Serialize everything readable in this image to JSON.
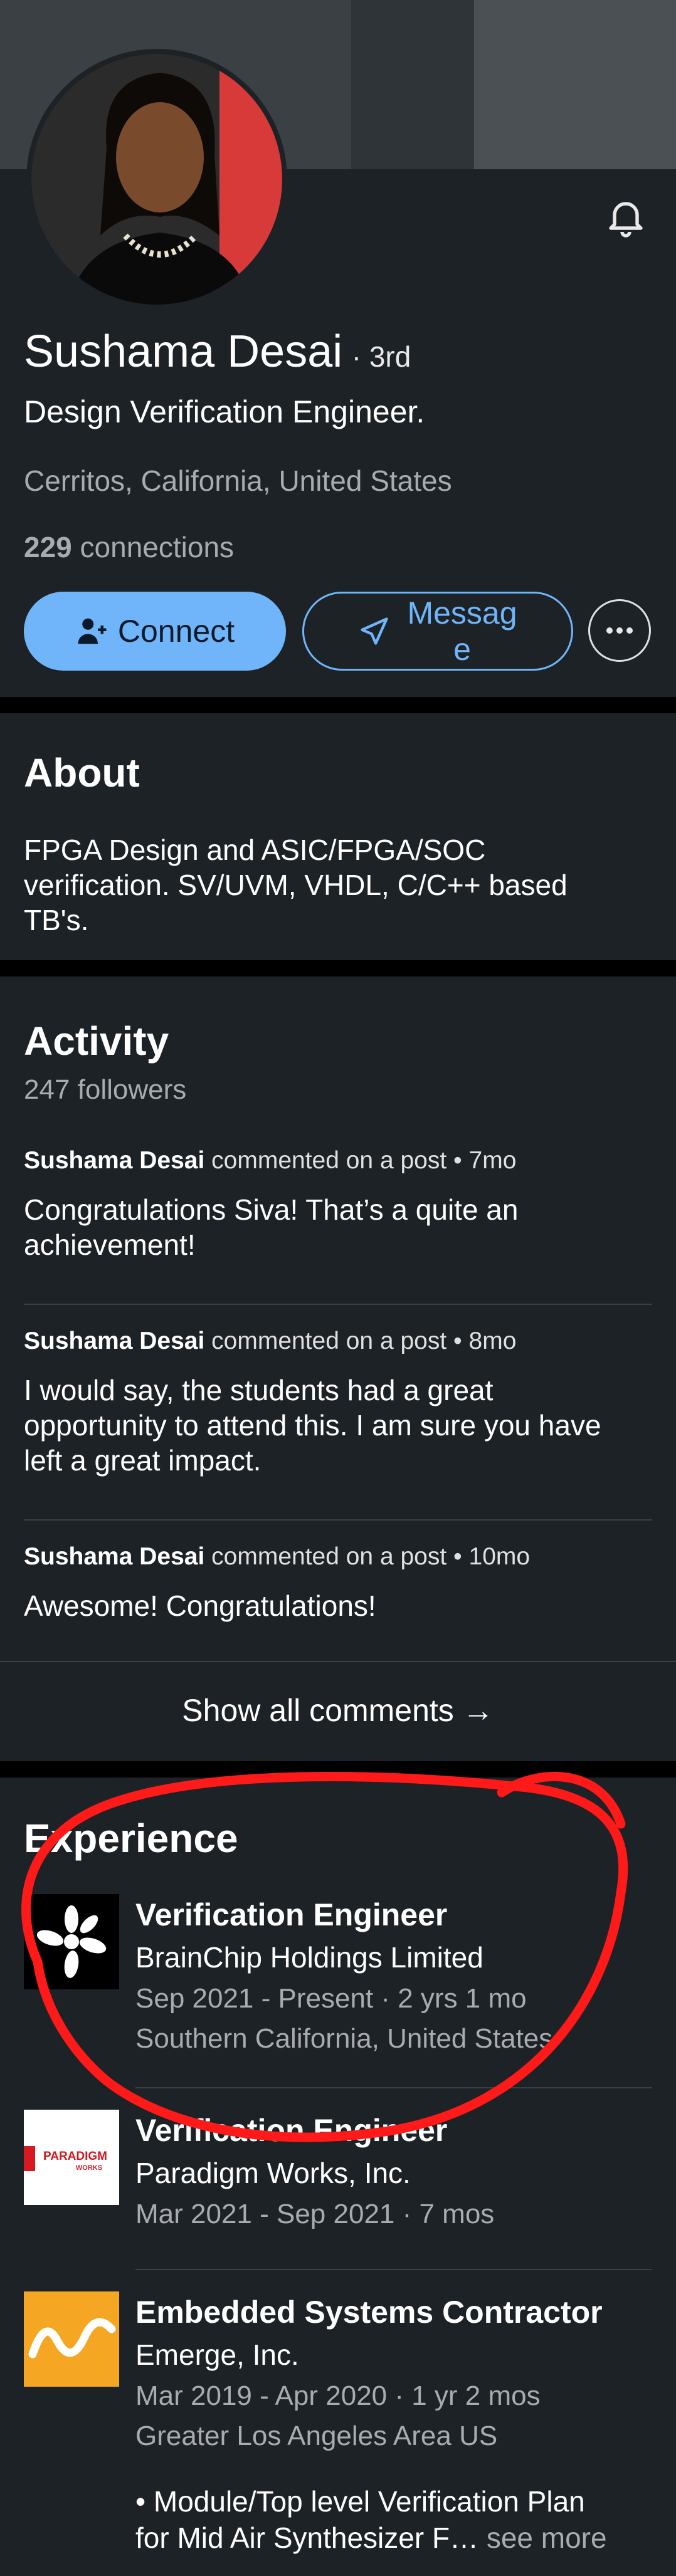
{
  "profile": {
    "name": "Sushama Desai",
    "degree": "· 3rd",
    "headline": "Design Verification Engineer.",
    "location": "Cerritos, California, United States",
    "connections_count": "229",
    "connections_label": "connections"
  },
  "actions": {
    "connect_label": "Connect",
    "message_label_line1": "Messag",
    "message_label_line2": "e"
  },
  "about": {
    "title": "About",
    "lines": [
      "FPGA Design and ASIC/FPGA/SOC",
      "verification. SV/UVM, VHDL, C/C++ based",
      "TB's."
    ]
  },
  "activity": {
    "title": "Activity",
    "followers": "247 followers",
    "items": [
      {
        "author": "Sushama Desai",
        "meta": " commented on a post • 7mo",
        "lines": [
          "Congratulations Siva! That’s a  quite an",
          "achievement!"
        ]
      },
      {
        "author": "Sushama Desai",
        "meta": " commented on a post • 8mo",
        "lines": [
          "I would say, the students had a great",
          "opportunity to attend this. I am sure you have",
          "left a great impact."
        ]
      },
      {
        "author": "Sushama Desai",
        "meta": " commented on a post • 10mo",
        "lines": [
          "Awesome! Congratulations!"
        ]
      }
    ],
    "show_all": "Show all comments →"
  },
  "experience": {
    "title": "Experience",
    "items": [
      {
        "title": "Verification Engineer",
        "company": "BrainChip Holdings Limited",
        "dates": "Sep 2021 - Present · 2 yrs 1 mo",
        "location": "Southern California, United States"
      },
      {
        "title": "Verification Engineer",
        "company": "Paradigm Works, Inc.",
        "dates": "Mar 2021 - Sep 2021 · 7 mos",
        "logo_text": "PARADIGM",
        "logo_subtext": "WORKS"
      },
      {
        "title": "Embedded Systems Contractor",
        "company": "Emerge, Inc.",
        "dates": "Mar 2019 - Apr 2020 · 1 yr 2 mos",
        "location": "Greater Los Angeles Area US",
        "desc_line1": "• Module/Top level Verification Plan",
        "desc_line2": "for Mid Air Synthesizer F…",
        "see_more": " see more"
      }
    ]
  },
  "colors": {
    "accent": "#70b5f9",
    "background": "#1d2226",
    "annotation": "#ff1a1a",
    "emerge_logo": "#f5a623"
  }
}
